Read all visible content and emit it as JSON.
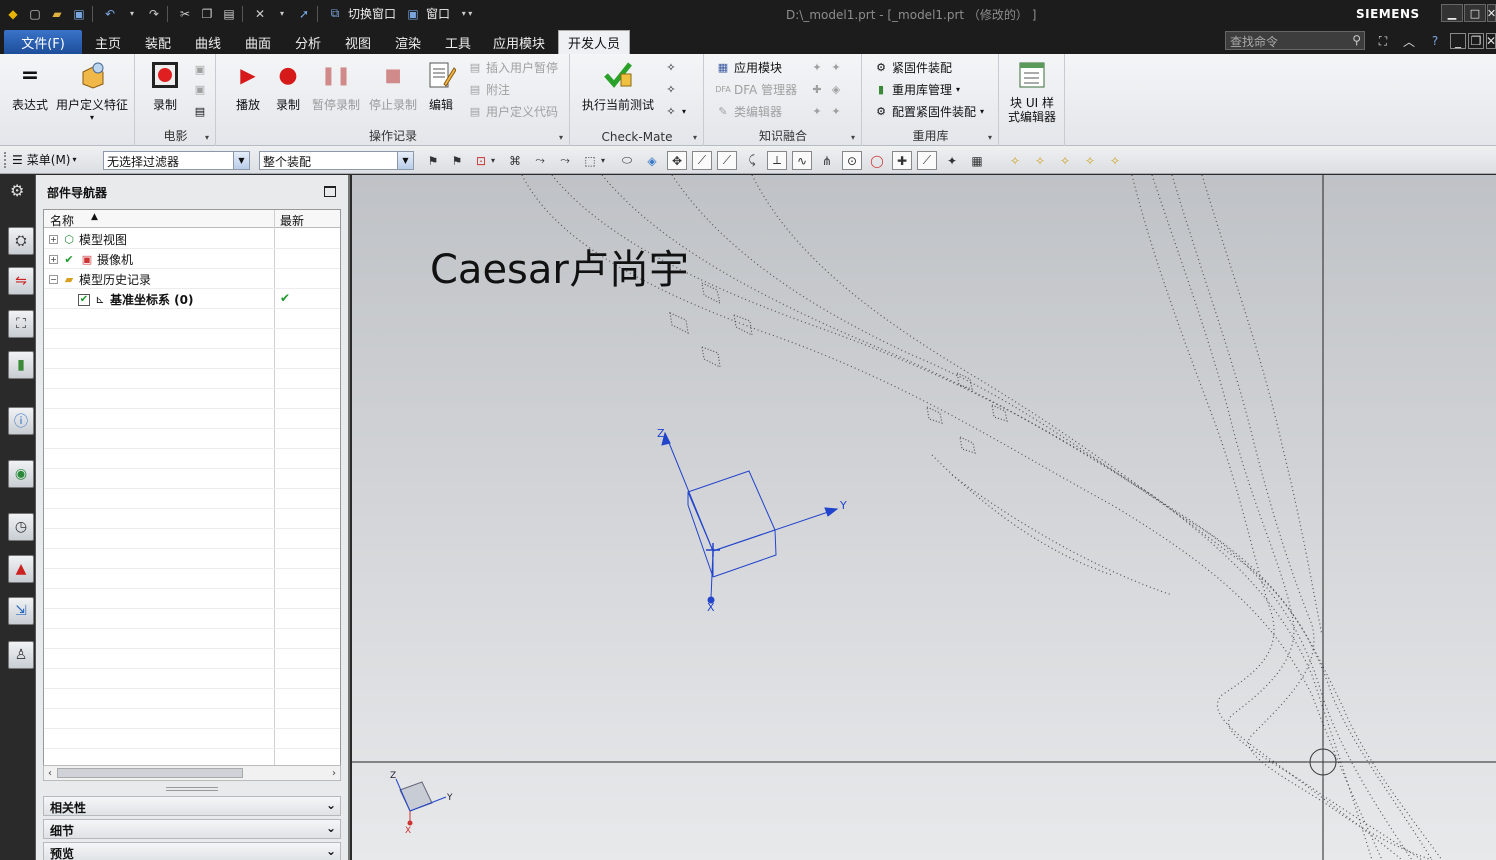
{
  "titlebar": {
    "switch_window": "切换窗口",
    "window_menu": "窗口",
    "document_title": "D:\\_model1.prt - [_model1.prt （修改的） ]",
    "brand": "SIEMENS"
  },
  "tabs": [
    {
      "label": "文件(F)"
    },
    {
      "label": "主页"
    },
    {
      "label": "装配"
    },
    {
      "label": "曲线"
    },
    {
      "label": "曲面"
    },
    {
      "label": "分析"
    },
    {
      "label": "视图"
    },
    {
      "label": "渲染"
    },
    {
      "label": "工具"
    },
    {
      "label": "应用模块"
    },
    {
      "label": "开发人员"
    }
  ],
  "search": {
    "placeholder": "查找命令"
  },
  "ribbon": {
    "expression": "表达式",
    "udf": "用户定义特征",
    "movie": {
      "record": "录制",
      "group": "电影"
    },
    "oprecord": {
      "play": "播放",
      "record": "录制",
      "pause": "暂停录制",
      "stop": "停止录制",
      "edit": "编辑",
      "insert_pause": "插入用户暂停",
      "annotate": "附注",
      "user_code": "用户定义代码",
      "group": "操作记录"
    },
    "checkmate": {
      "run": "执行当前测试",
      "group": "Check-Mate"
    },
    "knowledge": {
      "app_module": "应用模块",
      "dfa": "DFA 管理器",
      "class_editor": "类编辑器",
      "group": "知识融合"
    },
    "reuse": {
      "fastener": "紧固件装配",
      "lib_manage": "重用库管理",
      "config_fastener": "配置紧固件装配",
      "group": "重用库"
    },
    "blockui": {
      "label_line1": "块 UI 样",
      "label_line2": "式编辑器"
    }
  },
  "toolbar": {
    "menu": "菜单(M)",
    "filter": "无选择过滤器",
    "scope": "整个装配"
  },
  "navigator": {
    "title": "部件导航器",
    "col_name": "名称",
    "col_latest": "最新",
    "nodes": [
      {
        "label": "模型视图"
      },
      {
        "label": "摄像机"
      },
      {
        "label": "模型历史记录"
      },
      {
        "label": "基准坐标系 (0)"
      }
    ],
    "panels": [
      "相关性",
      "细节",
      "预览"
    ]
  },
  "graphics": {
    "overlay_text": "Caesar卢尚宇",
    "axis_z": "Z",
    "axis_y": "Y",
    "axis_x": "X"
  },
  "colors": {
    "accent": "#1d4e9a",
    "datum_csys": "#2244cc"
  }
}
